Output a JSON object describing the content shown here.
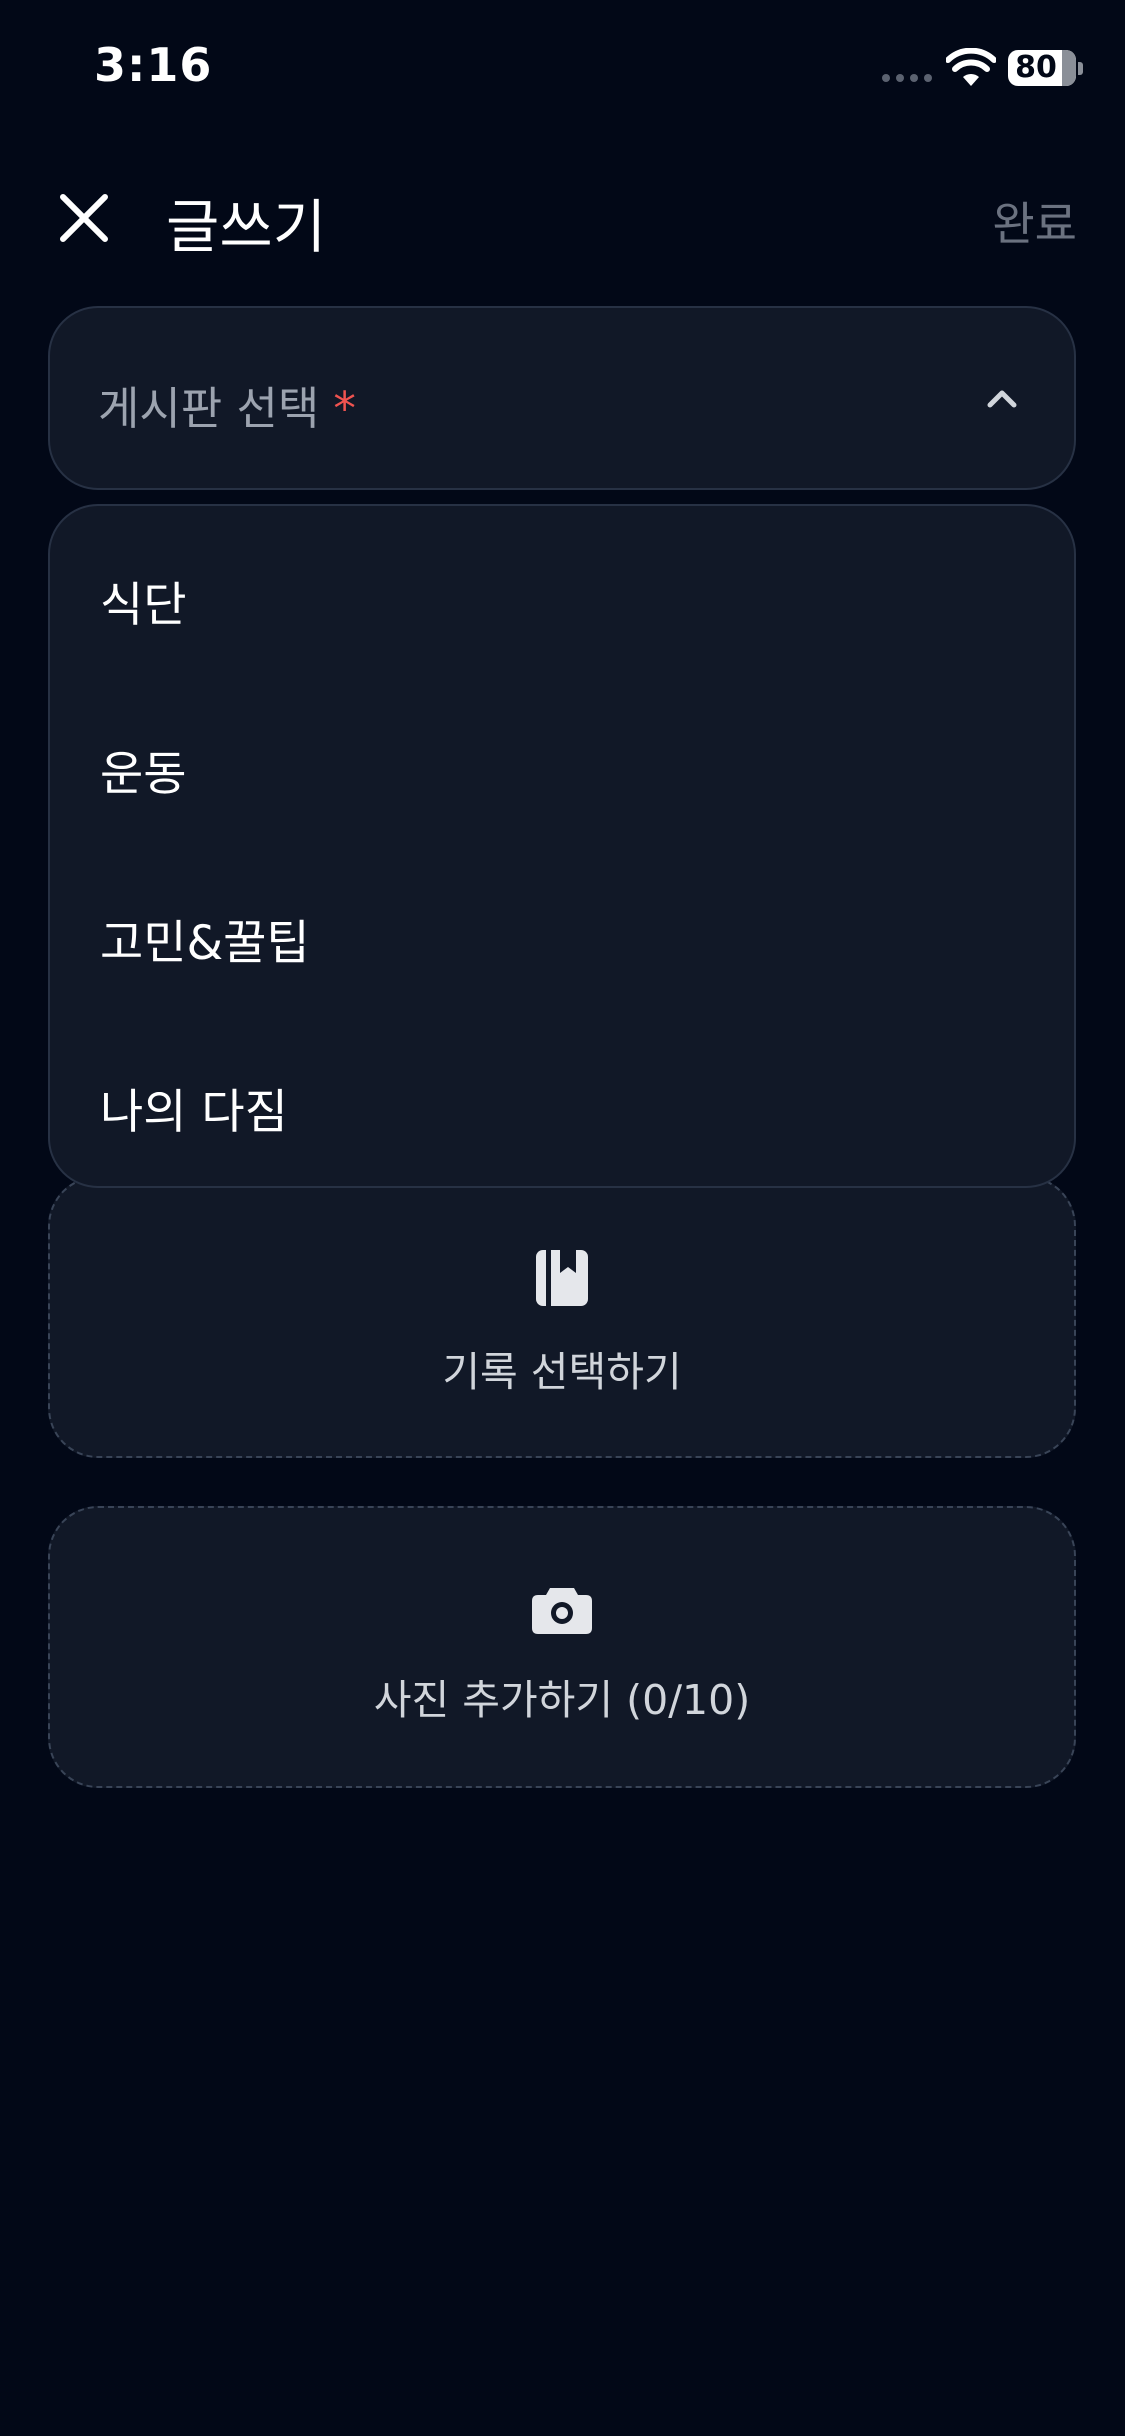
{
  "status_bar": {
    "time": "3:16",
    "battery_percent": 80,
    "battery_label": "80",
    "wifi_icon": "wifi-icon",
    "signal_icon": "cellular-signal-icon"
  },
  "header": {
    "close_icon": "close-icon",
    "title": "글쓰기",
    "done_label": "완료"
  },
  "board_select": {
    "placeholder": "게시판 선택",
    "required_mark": "*",
    "chevron_icon": "chevron-up-icon",
    "expanded": true,
    "options": [
      {
        "label": "식단"
      },
      {
        "label": "운동"
      },
      {
        "label": "고민&꿀팁"
      },
      {
        "label": "나의 다짐"
      }
    ]
  },
  "record_select": {
    "icon": "bookmark-journal-icon",
    "label": "기록 선택하기"
  },
  "photo_add": {
    "icon": "camera-icon",
    "label": "사진 추가하기 (0/10)"
  },
  "colors": {
    "background": "#020817",
    "surface": "#111827",
    "border": "#273144",
    "required": "#ef5350",
    "muted_text": "#9ca3af",
    "done_disabled": "#6b7280"
  }
}
